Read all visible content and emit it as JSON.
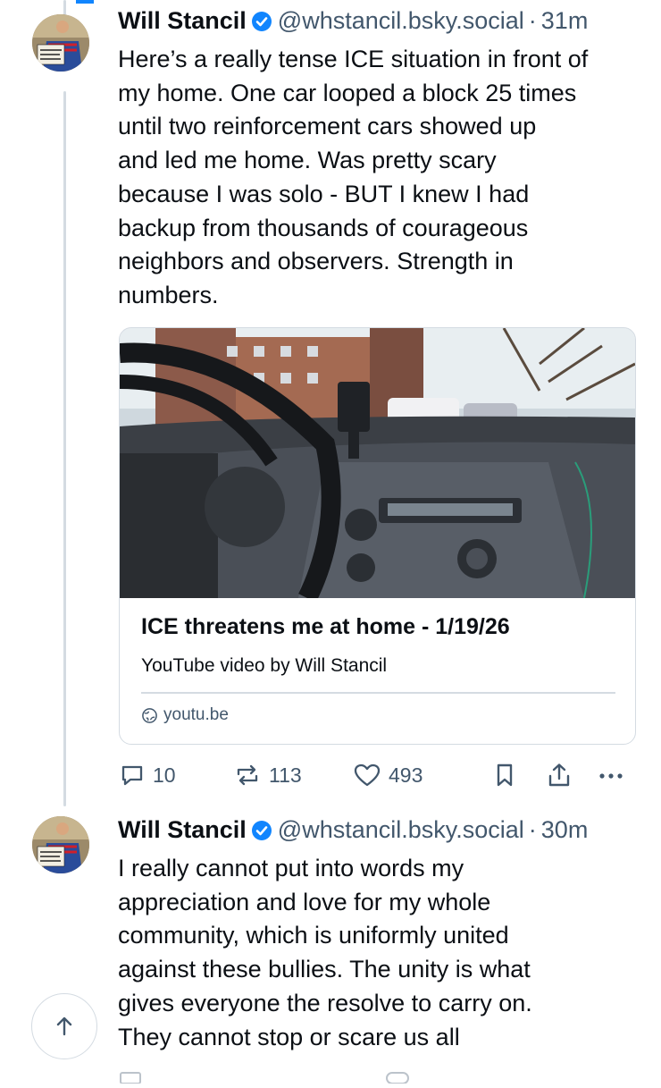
{
  "posts": [
    {
      "author_name": "Will Stancil",
      "handle": "@whstancil.bsky.social",
      "separator": "·",
      "time": "31m",
      "avatar_sign_text": "There are more of us than them",
      "body_lines": [
        "Here’s a really tense ICE situation in front of",
        "my home. One car looped a block 25 times",
        "until two reinforcement cars showed up",
        "and led me home. Was pretty scary",
        "because I was solo - BUT I knew I had",
        "backup from thousands of courageous",
        "neighbors and observers. Strength in",
        "numbers."
      ],
      "link_card": {
        "title": "ICE threatens me at home - 1/19/26",
        "description": "YouTube video by Will Stancil",
        "domain": "youtu.be",
        "thumbnail": "dashboard-view-from-car"
      },
      "actions": {
        "replies": "10",
        "reposts": "113",
        "likes": "493",
        "bookmark_icon": "bookmark-icon",
        "share_icon": "share-icon",
        "more_icon": "more-icon"
      }
    },
    {
      "author_name": "Will Stancil",
      "handle": "@whstancil.bsky.social",
      "separator": "·",
      "time": "30m",
      "avatar_sign_text": "There are more of us than them",
      "body_lines": [
        "I really cannot put into words my",
        "appreciation and love for my whole",
        "community, which is uniformly united",
        "against these bullies. The unity is what",
        "gives everyone the resolve to carry on.",
        "They cannot stop or scare us all"
      ]
    }
  ],
  "scroll_top_icon": "arrow-up-icon",
  "colors": {
    "accent": "#1185fe",
    "muted_text": "#42576c",
    "border": "#d4dbe2",
    "text": "#0b0f14"
  }
}
